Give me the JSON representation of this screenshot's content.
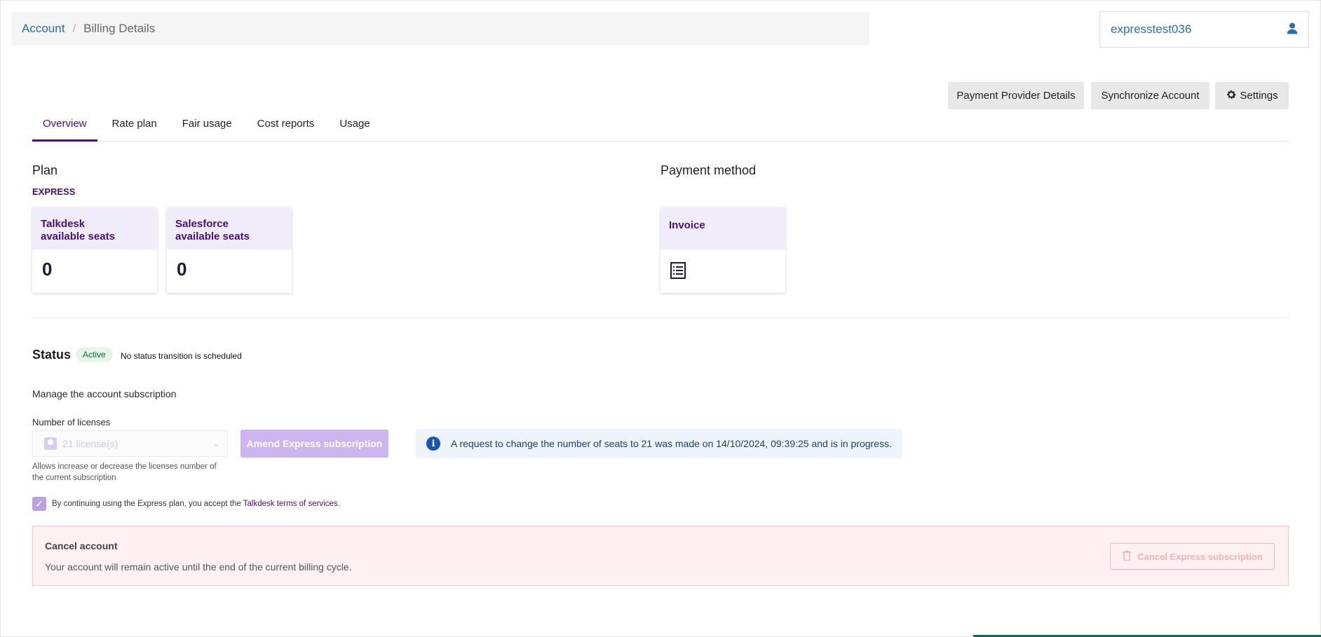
{
  "breadcrumb": {
    "link": "Account",
    "separator": "/",
    "current": "Billing Details"
  },
  "user": {
    "name": "expresstest036",
    "icon": "user-icon"
  },
  "actions": {
    "payment_provider_details": "Payment Provider Details",
    "synchronize_account": "Synchronize Account",
    "settings": "Settings"
  },
  "tabs": [
    {
      "label": "Overview",
      "active": true
    },
    {
      "label": "Rate plan",
      "active": false
    },
    {
      "label": "Fair usage",
      "active": false
    },
    {
      "label": "Cost reports",
      "active": false
    },
    {
      "label": "Usage",
      "active": false
    }
  ],
  "plan": {
    "title": "Plan",
    "name": "EXPRESS",
    "cards": [
      {
        "label_line1": "Talkdesk",
        "label_line2": "available seats",
        "value": "0"
      },
      {
        "label_line1": "Salesforce",
        "label_line2": "available seats",
        "value": "0"
      }
    ]
  },
  "payment": {
    "title": "Payment method",
    "method": "Invoice",
    "icon": "invoice-icon"
  },
  "status": {
    "title": "Status",
    "badge": "Active",
    "note": "No status transition is scheduled"
  },
  "subscription": {
    "manage_title": "Manage the account subscription",
    "licenses_label": "Number of licenses",
    "licenses_value": "21 license(s)",
    "licenses_help": "Allows increase or decrease the licenses number of the current subscription",
    "amend_button": "Amend Express subscription",
    "info_message": "A request to change the number of seats to 21 was made on 14/10/2024, 09:39:25 and is in progress.",
    "terms_text": "By continuing using the Express plan, you accept the",
    "terms_link": "Talkdesk terms of services",
    "terms_end": ".",
    "terms_checked": true
  },
  "cancel": {
    "title": "Cancel account",
    "description": "Your account will remain active until the end of the current billing cycle.",
    "button": "Cancel Express subscription"
  },
  "colors": {
    "accent": "#4b0f73",
    "link": "#2a6db0",
    "info_bg": "#eef4fb",
    "danger_bg": "#fff1f1"
  }
}
